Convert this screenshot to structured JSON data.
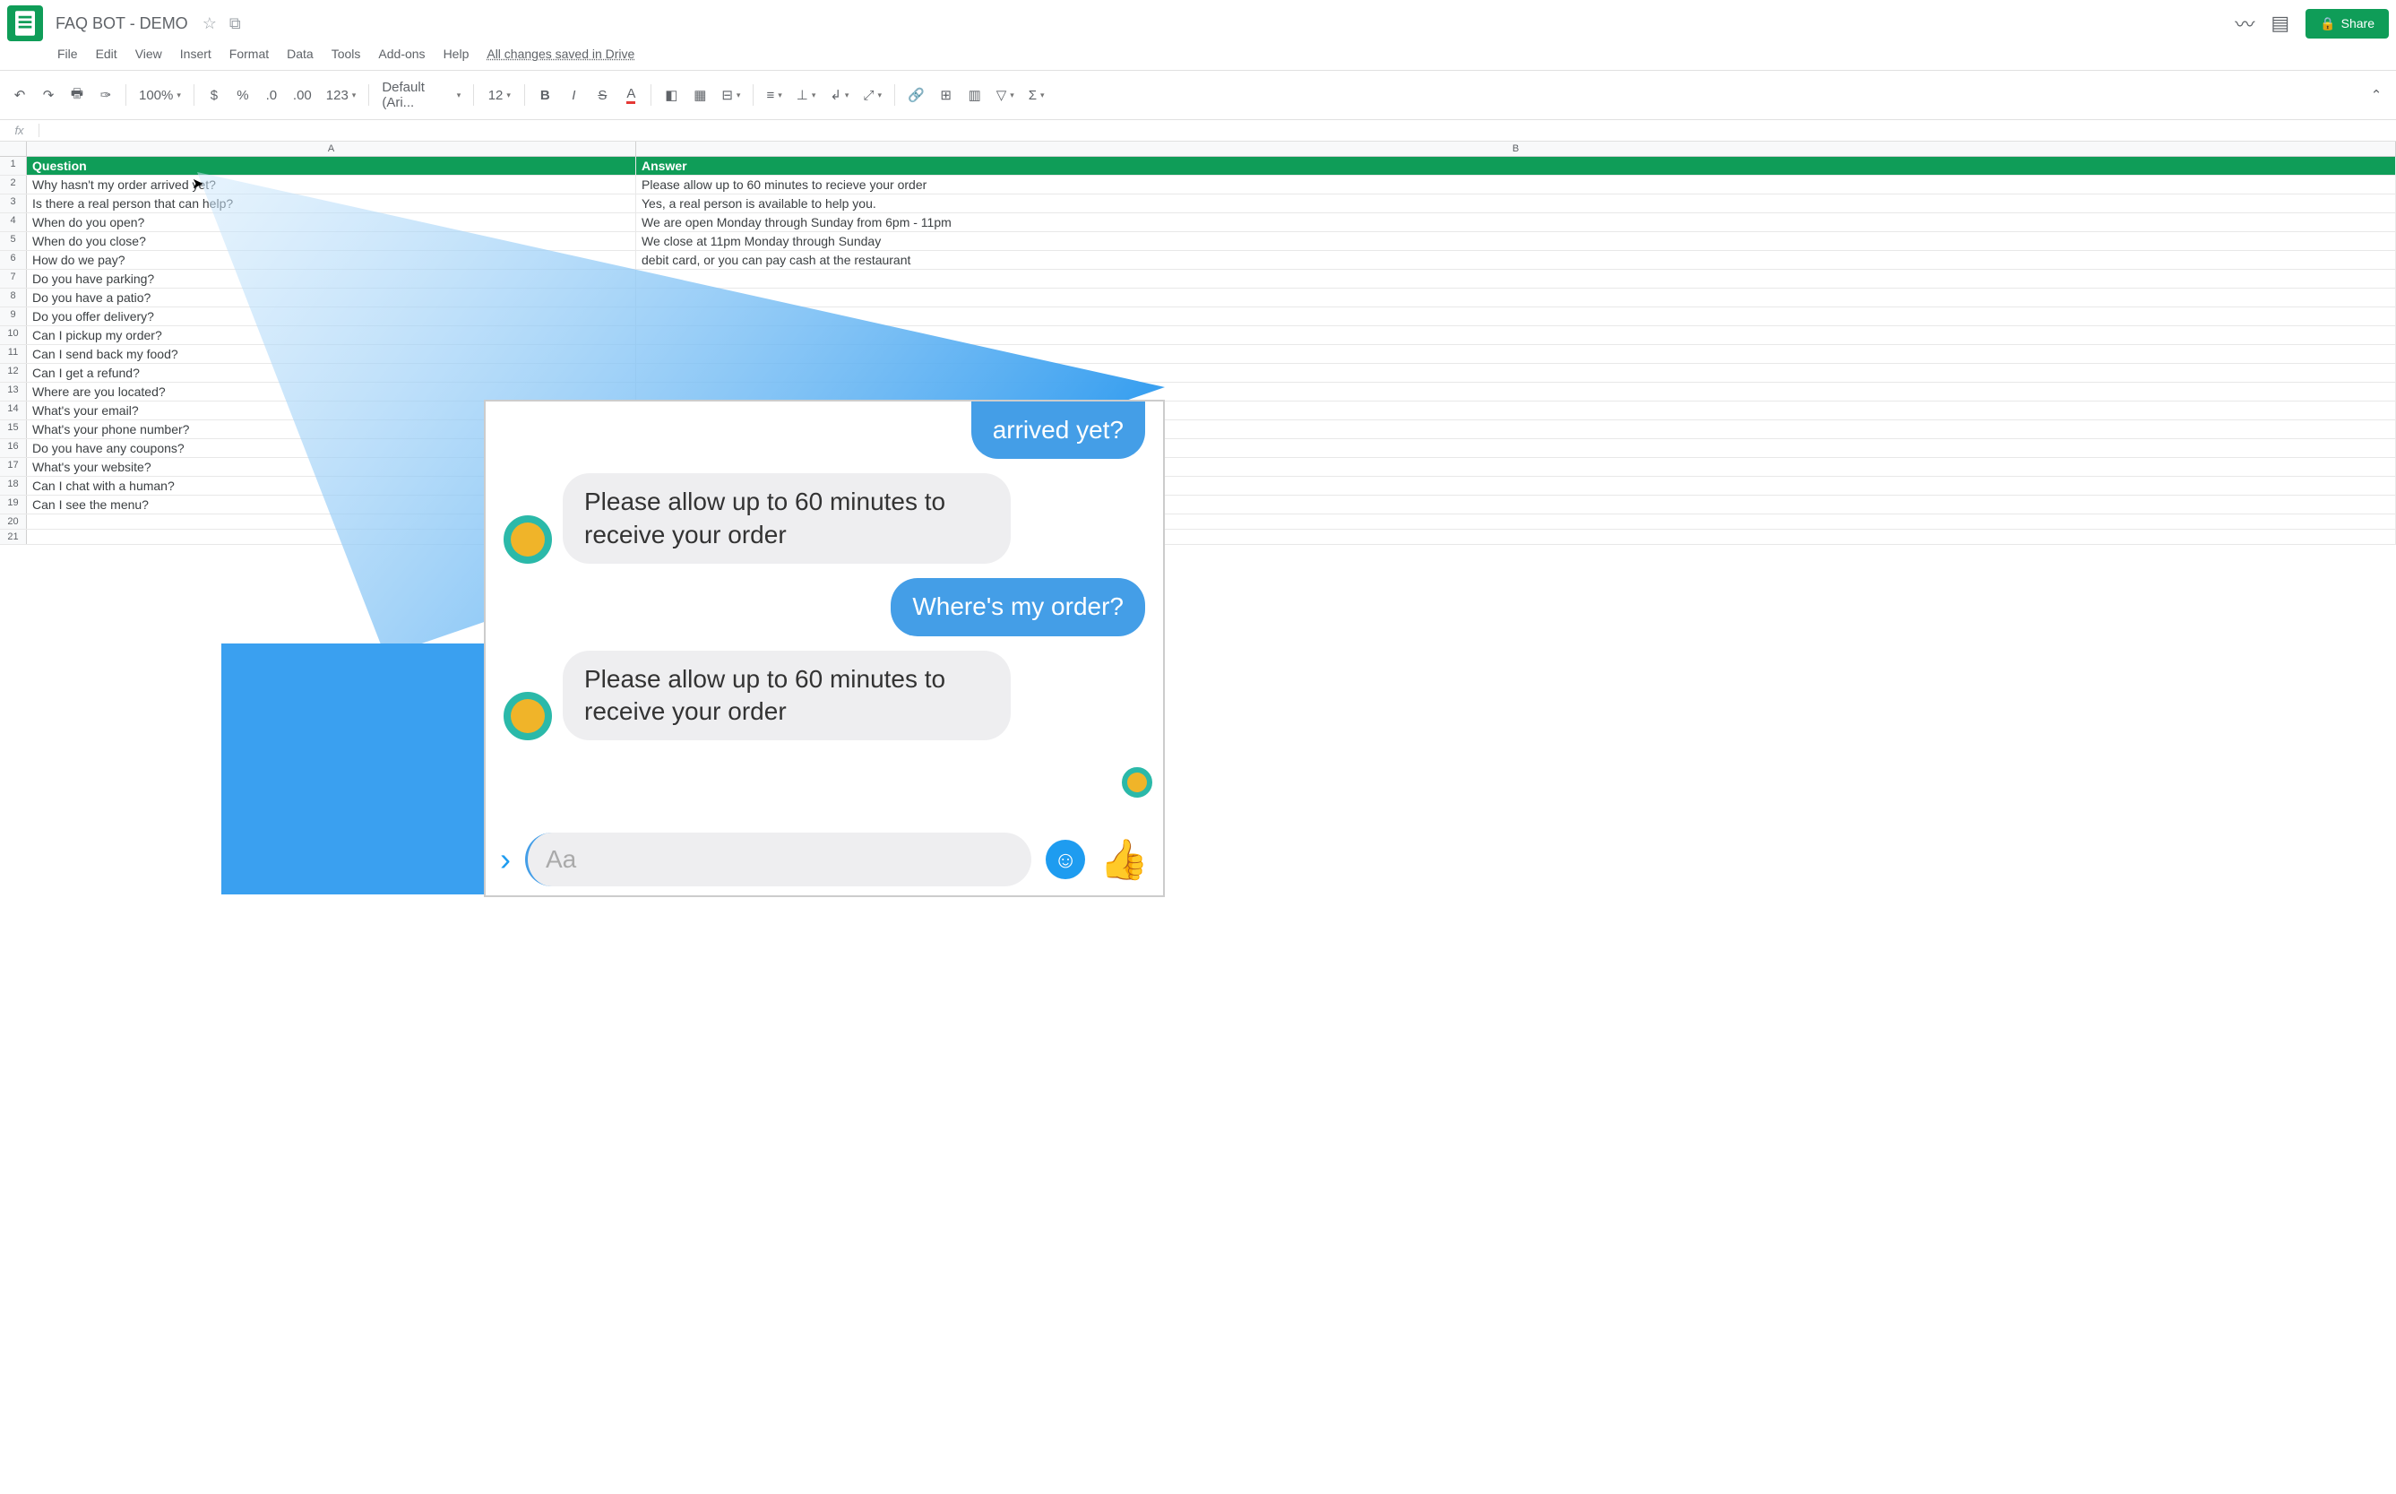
{
  "doc": {
    "title": "FAQ BOT - DEMO",
    "saved": "All changes saved in Drive"
  },
  "share": {
    "label": "Share"
  },
  "menu": [
    "File",
    "Edit",
    "View",
    "Insert",
    "Format",
    "Data",
    "Tools",
    "Add-ons",
    "Help"
  ],
  "toolbar": {
    "zoom": "100%",
    "format_num": "123",
    "font": "Default (Ari...",
    "size": "12"
  },
  "columns": [
    "A",
    "B"
  ],
  "table": {
    "header": {
      "q": "Question",
      "a": "Answer"
    },
    "rows": [
      {
        "q": "Why hasn't my order arrived yet?",
        "a": "Please allow up to 60 minutes to recieve your order"
      },
      {
        "q": "Is there a real person that can help?",
        "a": "Yes, a real person is available to help you."
      },
      {
        "q": "When do you open?",
        "a": "We are open Monday through Sunday from 6pm - 11pm"
      },
      {
        "q": "When do you close?",
        "a": "We close at 11pm Monday through Sunday"
      },
      {
        "q": "How do we pay?",
        "a": "debit card, or you can pay cash at the restaurant"
      },
      {
        "q": "Do you have parking?",
        "a": ""
      },
      {
        "q": "Do you have a patio?",
        "a": ""
      },
      {
        "q": "Do you offer delivery?",
        "a": ""
      },
      {
        "q": "Can I pickup my order?",
        "a": ""
      },
      {
        "q": "Can I send back my food?",
        "a": ""
      },
      {
        "q": "Can I get a refund?",
        "a": ""
      },
      {
        "q": "Where are you located?",
        "a": ""
      },
      {
        "q": "What's your email?",
        "a": ""
      },
      {
        "q": "What's your phone number?",
        "a": ""
      },
      {
        "q": "Do you have any coupons?",
        "a": ""
      },
      {
        "q": "What's your website?",
        "a": ""
      },
      {
        "q": "Can I chat with a human?",
        "a": ""
      },
      {
        "q": "Can I see the menu?",
        "a": ""
      }
    ]
  },
  "chat": {
    "m1": "arrived yet?",
    "m2": "Please allow up to 60 minutes to receive your order",
    "m3": "Where's my order?",
    "m4": "Please allow up to 60 minutes to receive your order",
    "placeholder": "Aa"
  }
}
